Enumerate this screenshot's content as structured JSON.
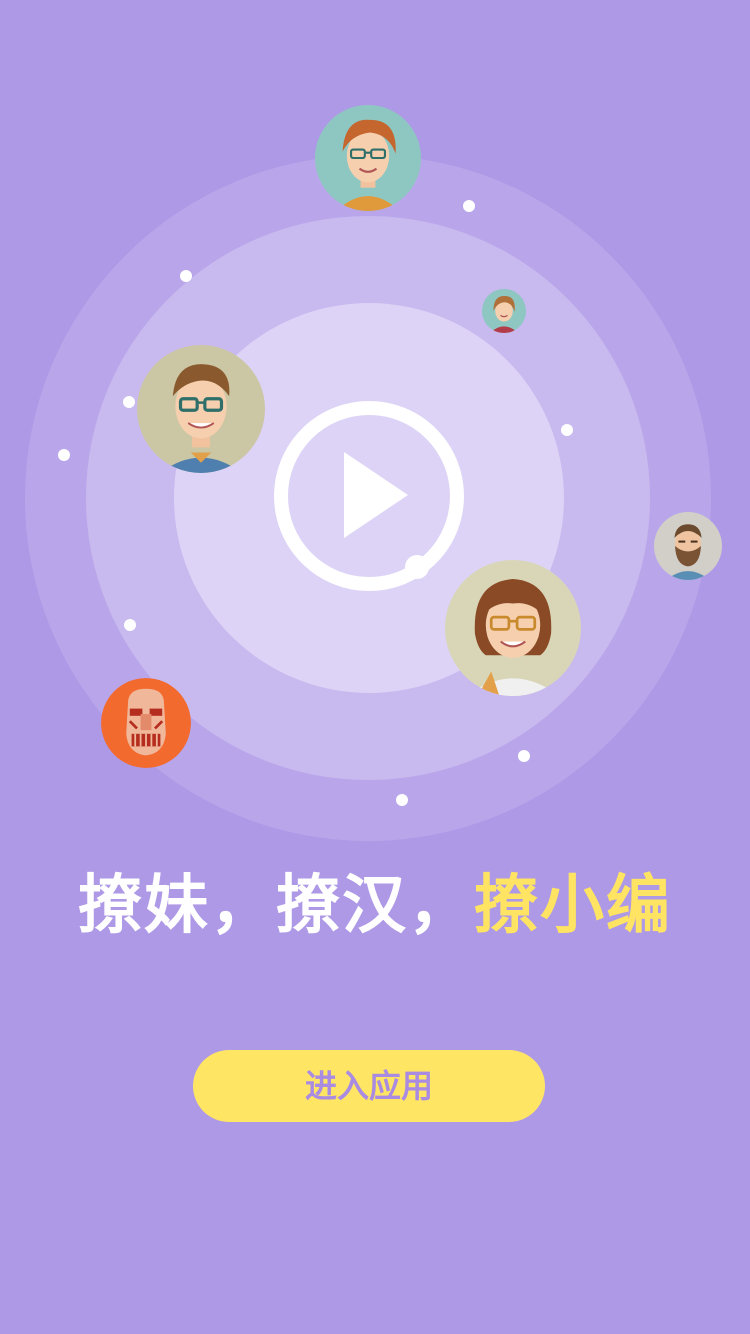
{
  "slogan": {
    "part1": "撩妹，撩汉，",
    "part2": "撩小编"
  },
  "enter_button": {
    "label": "进入应用"
  },
  "colors": {
    "background": "#ae99e6",
    "accent": "#ffe362",
    "button": "#ffe564",
    "button_text": "#a98be2"
  },
  "avatars": [
    {
      "name": "woman-with-glasses"
    },
    {
      "name": "small-woman"
    },
    {
      "name": "man-with-glasses"
    },
    {
      "name": "bearded-man"
    },
    {
      "name": "woman-with-bangs"
    },
    {
      "name": "titan-face"
    }
  ]
}
